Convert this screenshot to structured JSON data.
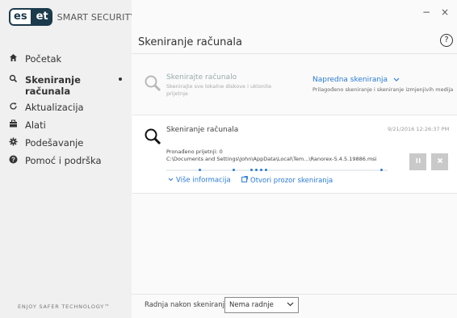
{
  "app": {
    "logo_es": "es",
    "logo_et": "et",
    "logo_text": "SMART SECURITY",
    "tagline": "ENJOY SAFER TECHNOLOGY™"
  },
  "window": {
    "minimize": "−",
    "close": "×"
  },
  "page": {
    "title": "Skeniranje računala",
    "help": "?"
  },
  "sidebar": {
    "items": [
      {
        "label": "Početak",
        "icon": "home-icon"
      },
      {
        "label": "Skeniranje računala",
        "icon": "search-icon",
        "active": true
      },
      {
        "label": "Aktualizacija",
        "icon": "refresh-icon"
      },
      {
        "label": "Alati",
        "icon": "briefcase-icon"
      },
      {
        "label": "Podešavanje",
        "icon": "gear-icon"
      },
      {
        "label": "Pomoć i podrška",
        "icon": "help-icon"
      }
    ]
  },
  "options": {
    "scan": {
      "title": "Skenirajte računalo",
      "desc": "Skenirajte sve lokalne diskove i uklonite prijetnje"
    },
    "advanced": {
      "title": "Napredna skeniranja",
      "desc": "Prilagođeno skeniranje i skeniranje izmjenjivih medija"
    }
  },
  "scan_card": {
    "title": "Skeniranje računala",
    "timestamp": "9/21/2016 12:26:37 PM",
    "found": "Pronađeno prijetnji: 0",
    "path": "C:\\Documents and Settings\\John\\AppData\\Local\\Tem...\\Ranorex-5.4.5.19886.msi",
    "more_info": "Više informacija",
    "open_window": "Otvori prozor skeniranja"
  },
  "footer": {
    "label": "Radnja nakon skeniranja",
    "select_value": "Nema radnje"
  },
  "colors": {
    "accent": "#2a7bd5",
    "logo_dark": "#1b3a4b",
    "sidebar_bg": "#f0f0f0"
  }
}
